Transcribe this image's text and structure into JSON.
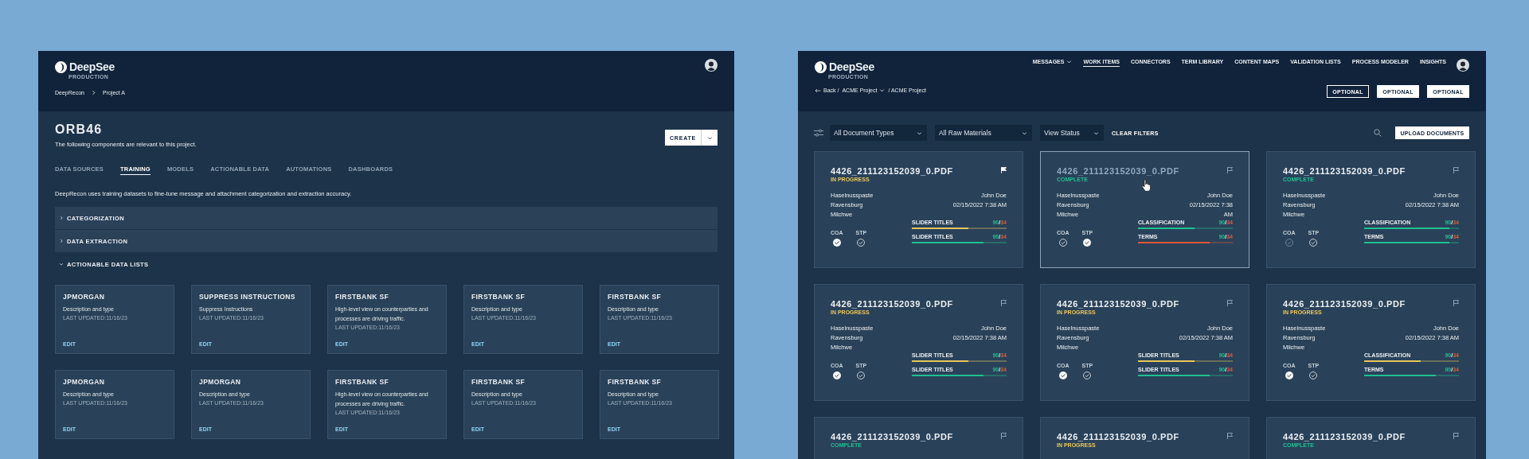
{
  "left_window": {
    "logo": {
      "name": "DeepSee",
      "environment": "PRODUCTION"
    },
    "breadcrumb": [
      "DeepRecon",
      "Project A"
    ],
    "title": "ORB46",
    "subtitle": "The following components are relevant to this project.",
    "create_button": "CREATE",
    "tabs": [
      {
        "label": "DATA SOURCES",
        "selected": false
      },
      {
        "label": "TRAINING",
        "selected": true
      },
      {
        "label": "MODELS",
        "selected": false
      },
      {
        "label": "ACTIONABLE DATA",
        "selected": false
      },
      {
        "label": "AUTOMATIONS",
        "selected": false
      },
      {
        "label": "DASHBOARDS",
        "selected": false
      }
    ],
    "description": "DeepRecon uses training datasets to fine-tune message and attachment categorization and extraction accuracy.",
    "sections": [
      {
        "label": "CATEGORIZATION",
        "expanded": false
      },
      {
        "label": "DATA EXTRACTION",
        "expanded": false
      },
      {
        "label": "ACTIONABLE DATA LISTS",
        "expanded": true
      }
    ],
    "cards": [
      {
        "title": "JPMORGAN",
        "description": "Description and type",
        "updated": "LAST UPDATED:11/16/23",
        "action": "EDIT"
      },
      {
        "title": "SUPPRESS INSTRUCTIONS",
        "description": "Suppress Instructions",
        "updated": "LAST UPDATED:11/16/23",
        "action": "EDIT"
      },
      {
        "title": "FIRSTBANK SF",
        "description": "High-level view on counterparties and processes are driving traffic.",
        "updated": "LAST UPDATED:11/16/23",
        "action": "EDIT"
      },
      {
        "title": "FIRSTBANK SF",
        "description": "Description and type",
        "updated": "LAST UPDATED:11/16/23",
        "action": "EDIT"
      },
      {
        "title": "FIRSTBANK SF",
        "description": "Description and type",
        "updated": "LAST UPDATED:11/16/23",
        "action": "EDIT"
      },
      {
        "title": "JPMORGAN",
        "description": "Description and type",
        "updated": "LAST UPDATED:11/16/23",
        "action": "EDIT"
      },
      {
        "title": "JPMORGAN",
        "description": "Description and type",
        "updated": "LAST UPDATED:11/16/23",
        "action": "EDIT"
      },
      {
        "title": "FIRSTBANK SF",
        "description": "High-level view on counterparties and processes are driving traffic.",
        "updated": "LAST UPDATED:11/16/23",
        "action": "EDIT"
      },
      {
        "title": "FIRSTBANK SF",
        "description": "Description and type",
        "updated": "LAST UPDATED:11/16/23",
        "action": "EDIT"
      },
      {
        "title": "FIRSTBANK SF",
        "description": "Description and type",
        "updated": "LAST UPDATED:11/16/23",
        "action": "EDIT"
      }
    ]
  },
  "right_window": {
    "logo": {
      "name": "DeepSee",
      "environment": "PRODUCTION"
    },
    "nav": [
      {
        "label": "MESSAGES",
        "selected": false,
        "dropdown": true
      },
      {
        "label": "WORK ITEMS",
        "selected": true,
        "dropdown": false
      },
      {
        "label": "CONNECTORS",
        "selected": false,
        "dropdown": false
      },
      {
        "label": "TERM LIBRARY",
        "selected": false,
        "dropdown": false
      },
      {
        "label": "CONTENT MAPS",
        "selected": false,
        "dropdown": false
      },
      {
        "label": "VALIDATION LISTS",
        "selected": false,
        "dropdown": false
      },
      {
        "label": "PROCESS MODELER",
        "selected": false,
        "dropdown": false
      },
      {
        "label": "INSIGHTS",
        "selected": false,
        "dropdown": false
      }
    ],
    "breadcrumb": {
      "back": "Back /",
      "project": "ACME Project",
      "current": "/ ACME Project"
    },
    "header_buttons": [
      {
        "label": "OPTIONAL",
        "kind": "outline"
      },
      {
        "label": "OPTIONAL",
        "kind": "filled"
      },
      {
        "label": "OPTIONAL",
        "kind": "filled"
      }
    ],
    "filters": [
      {
        "value": "All Document Types"
      },
      {
        "value": "All Raw Materials"
      },
      {
        "value": "View Status"
      }
    ],
    "clear_filters": "CLEAR FILTERS",
    "upload_button": "UPLOAD DOCUMENTS",
    "documents": [
      {
        "title": "4426_211123152039_0.PDF",
        "status": {
          "label": "IN PROGRESS",
          "kind": "in_progress"
        },
        "flagged": true,
        "hovered": false,
        "details_left": [
          "Haselnusspaste",
          "Ravensburg",
          "Milchwe"
        ],
        "details_right": [
          "John Doe",
          "02/15/2022 7:38 AM"
        ],
        "checks": [
          {
            "label": "COA",
            "checked": true,
            "disabled": false
          },
          {
            "label": "STP",
            "checked": false,
            "disabled": false
          }
        ],
        "metrics": [
          {
            "label": "SLIDER TITLES",
            "color": "#e8c65a",
            "level": 0.6,
            "reading": {
              "passed": "90",
              "slash": "/",
              "failed": "34"
            }
          },
          {
            "label": "SLIDER TITLES",
            "color": "#1fbf93",
            "level": 0.76,
            "reading": {
              "passed": "90",
              "slash": "/",
              "failed": "34"
            }
          }
        ]
      },
      {
        "title": "4426_211123152039_0.PDF",
        "status": {
          "label": "COMPLETE",
          "kind": "complete"
        },
        "flagged": false,
        "hovered": true,
        "details_left": [
          "Haselnusspaste",
          "Ravensburg",
          "Milchwe"
        ],
        "details_right": [
          "John Doe",
          "02/15/2022 7:38",
          "AM"
        ],
        "checks": [
          {
            "label": "COA",
            "checked": false,
            "disabled": false
          },
          {
            "label": "STP",
            "checked": true,
            "disabled": false
          }
        ],
        "metrics": [
          {
            "label": "CLASSIFICATION",
            "color": "#1fbf93",
            "level": 0.6,
            "reading": {
              "passed": "90",
              "slash": "/",
              "failed": "34"
            }
          },
          {
            "label": "TERMS",
            "color": "#e0553c",
            "level": 0.76,
            "reading": {
              "passed": "90",
              "slash": "/",
              "failed": "34"
            }
          }
        ]
      },
      {
        "title": "4426_211123152039_0.PDF",
        "status": {
          "label": "COMPLETE",
          "kind": "complete"
        },
        "flagged": false,
        "hovered": false,
        "details_left": [
          "Haselnusspaste",
          "Ravensburg",
          "Milchwe"
        ],
        "details_right": [
          "John Doe",
          "02/15/2022 7:38 AM"
        ],
        "checks": [
          {
            "label": "COA",
            "checked": false,
            "disabled": true
          },
          {
            "label": "STP",
            "checked": false,
            "disabled": false
          }
        ],
        "metrics": [
          {
            "label": "CLASSIFICATION",
            "color": "#1fbf93",
            "level": 0.9,
            "reading": {
              "passed": "90",
              "slash": "/",
              "failed": "34"
            }
          },
          {
            "label": "TERMS",
            "color": "#1fbf93",
            "level": 0.9,
            "reading": {
              "passed": "90",
              "slash": "/",
              "failed": "34"
            }
          }
        ]
      },
      {
        "title": "4426_211123152039_0.PDF",
        "status": {
          "label": "IN PROGRESS",
          "kind": "in_progress"
        },
        "flagged": false,
        "hovered": false,
        "details_left": [
          "Haselnusspaste",
          "Ravensburg",
          "Milchwe"
        ],
        "details_right": [
          "John Doe",
          "02/15/2022 7:38 AM"
        ],
        "checks": [
          {
            "label": "COA",
            "checked": true,
            "disabled": false
          },
          {
            "label": "STP",
            "checked": false,
            "disabled": false
          }
        ],
        "metrics": [
          {
            "label": "SLIDER TITLES",
            "color": "#e8c65a",
            "level": 0.6,
            "reading": {
              "passed": "90",
              "slash": "/",
              "failed": "34"
            }
          },
          {
            "label": "SLIDER TITLES",
            "color": "#1fbf93",
            "level": 0.76,
            "reading": {
              "passed": "90",
              "slash": "/",
              "failed": "34"
            }
          }
        ]
      },
      {
        "title": "4426_211123152039_0.PDF",
        "status": {
          "label": "IN PROGRESS",
          "kind": "in_progress"
        },
        "flagged": false,
        "hovered": false,
        "details_left": [
          "Haselnusspaste",
          "Ravensburg",
          "Milchwe"
        ],
        "details_right": [
          "John Doe",
          "02/15/2022 7:38 AM"
        ],
        "checks": [
          {
            "label": "COA",
            "checked": true,
            "disabled": false
          },
          {
            "label": "STP",
            "checked": false,
            "disabled": false
          }
        ],
        "metrics": [
          {
            "label": "SLIDER TITLES",
            "color": "#e8c65a",
            "level": 0.6,
            "reading": {
              "passed": "90",
              "slash": "/",
              "failed": "34"
            }
          },
          {
            "label": "SLIDER TITLES",
            "color": "#1fbf93",
            "level": 0.76,
            "reading": {
              "passed": "90",
              "slash": "/",
              "failed": "34"
            }
          }
        ]
      },
      {
        "title": "4426_211123152039_0.PDF",
        "status": {
          "label": "IN PROGRESS",
          "kind": "in_progress"
        },
        "flagged": false,
        "hovered": false,
        "details_left": [
          "Haselnusspaste",
          "Ravensburg",
          "Milchwe"
        ],
        "details_right": [
          "John Doe",
          "02/15/2022 7:38 AM"
        ],
        "checks": [
          {
            "label": "COA",
            "checked": true,
            "disabled": false
          },
          {
            "label": "STP",
            "checked": false,
            "disabled": false
          }
        ],
        "metrics": [
          {
            "label": "CLASSIFICATION",
            "color": "#e8c65a",
            "level": 0.6,
            "reading": {
              "passed": "90",
              "slash": "/",
              "failed": "34"
            }
          },
          {
            "label": "TERMS",
            "color": "#1fbf93",
            "level": 0.76,
            "reading": {
              "passed": "90",
              "slash": "/",
              "failed": "34"
            }
          }
        ]
      },
      {
        "title": "4426_211123152039_0.PDF",
        "status": {
          "label": "COMPLETE",
          "kind": "complete"
        },
        "flagged": false,
        "hovered": false
      },
      {
        "title": "4426_211123152039_0.PDF",
        "status": {
          "label": "IN PROGRESS",
          "kind": "in_progress"
        },
        "flagged": false,
        "hovered": false
      },
      {
        "title": "4426_211123152039_0.PDF",
        "status": {
          "label": "COMPLETE",
          "kind": "complete"
        },
        "flagged": false,
        "hovered": false
      }
    ]
  }
}
